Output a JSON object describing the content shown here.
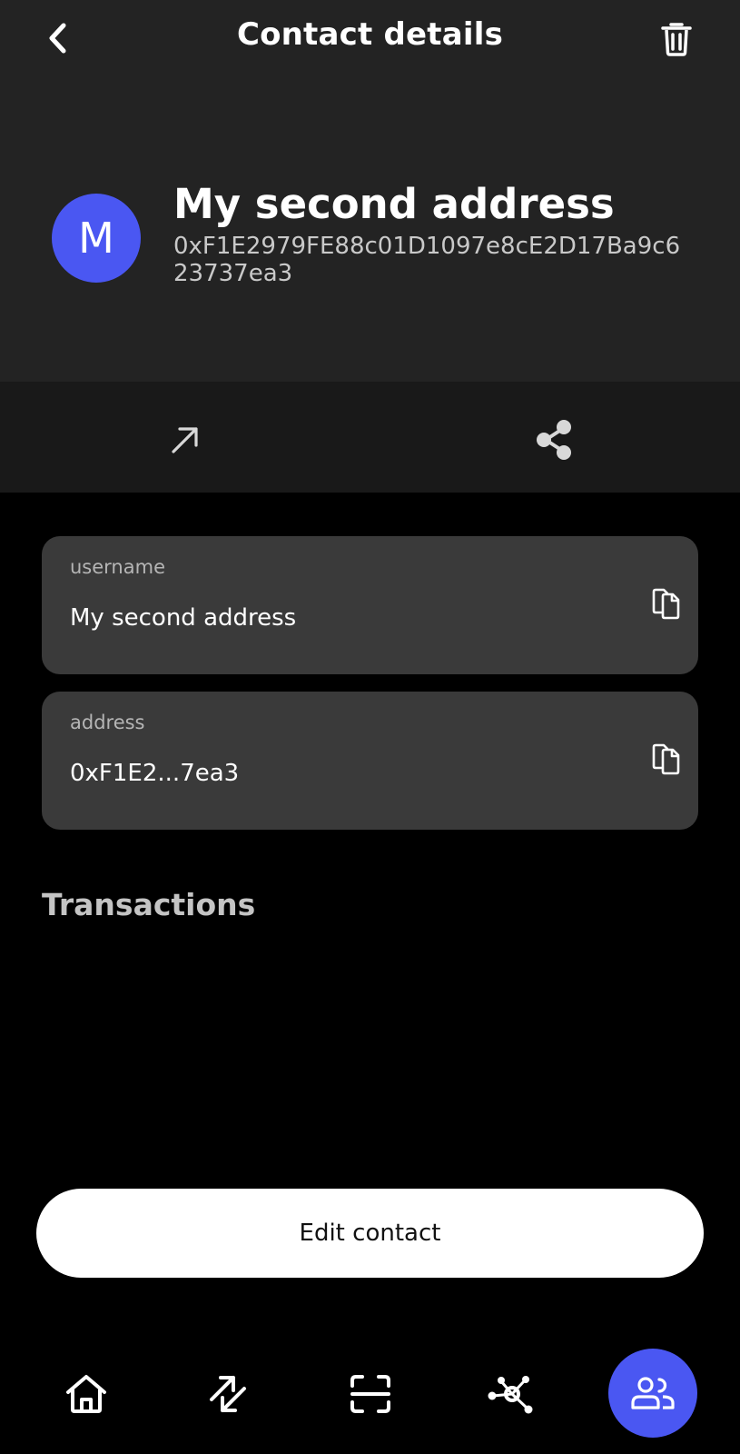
{
  "header": {
    "title": "Contact details",
    "back_icon": "chevron-left-icon",
    "delete_icon": "trash-icon"
  },
  "contact": {
    "avatar_letter": "M",
    "name": "My second address",
    "address": "0xF1E2979FE88c01D1097e8cE2D17Ba9c623737ea3"
  },
  "actions": {
    "send_icon": "arrow-up-right-icon",
    "share_icon": "share-icon"
  },
  "fields": [
    {
      "label": "username",
      "value": "My second address"
    },
    {
      "label": "address",
      "value": "0xF1E2...7ea3"
    }
  ],
  "transactions": {
    "title": "Transactions"
  },
  "edit_button": {
    "label": "Edit contact"
  },
  "bottom_nav": {
    "items": [
      "home-icon",
      "swap-icon",
      "scan-icon",
      "network-icon",
      "contacts-icon"
    ],
    "active": "contacts-icon"
  },
  "colors": {
    "accent": "#4a57f2",
    "header_bg": "#232323",
    "action_bar_bg": "#191919",
    "card_bg": "#3a3a3a",
    "page_bg": "#000000"
  }
}
